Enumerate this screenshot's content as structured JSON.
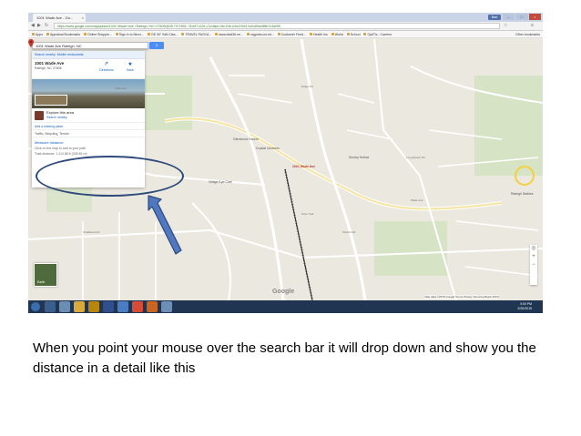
{
  "browser": {
    "tab_title": "1001 Wade Ave - Go...",
    "url": "https://www.google.com/maps/place/1001+Wade+Ave,+Raleigh,+NC+27605/@35.7971595,-78.6571226,17z/data=!3m1!4b1!4m2!3m1!1s0x89ac5f8b7c4af3f5",
    "user_badge": "Bart",
    "bookmarks": [
      "Apps",
      "Appraisal Bookmarks",
      "Online Shoppin...",
      "Sign in to Micro...",
      "GE 30\" Self-Clea...",
      "TRAVEL PACKA...",
      "www.deal36.ne...",
      "orgpubs.ucr.ed...",
      "Customer Feed...",
      "Health Ins",
      "World",
      "School",
      "OptiTix - Careers"
    ],
    "other_bookmarks": "Other bookmarks"
  },
  "maps": {
    "search_value": "1001 Wade Ave Raleigh, NC",
    "hint": "Search nearby: Mobile restaurants",
    "place_name": "1001 Wade Ave",
    "place_address": "Raleigh, NC 27605",
    "directions_label": "Directions",
    "save_label": "Save",
    "explore_title": "Explore this area",
    "explore_sub": "Search nearby",
    "missing_place": "Add a missing place",
    "traffic": "Traffic, Bicycling, Terrain",
    "measure_header": "Measure distance",
    "measure_hint": "Click on the map to add to your path",
    "total_distance": "Total distance: 1,114.88 ft",
    "total_distance_alt": "(339.81 m)",
    "pin_label": "1001 Wade Ave",
    "earth_label": "Earth",
    "google_logo": "Google",
    "map_footer": "Map data ©2015 Google   Terms   Privacy   Send feedback   200 ft",
    "labels": {
      "l1": "Village Eye Care",
      "l2": "Glenwood Towers",
      "l3": "Crystal Cleaners",
      "l4": "Wade Ave",
      "l5": "Smoky Hollow",
      "l6": "Raleigh Stables",
      "l7": "Long Beach Rd",
      "l8": "Dixie Trail",
      "l9": "Oberlin Rd",
      "l10": "Clark Ave",
      "l11": "Ridge Rd",
      "l12": "Smallwood Dr"
    }
  },
  "taskbar": {
    "time": "3:00 PM",
    "date": "2/20/2015"
  },
  "caption": "When you point your mouse over the search bar it will drop down and show you the distance in a detail like this",
  "colors": {
    "annotation": "#2e4a7a",
    "arrow_fill": "#4f77c2",
    "pin": "#c0392b",
    "accent": "#4d8ef4"
  }
}
